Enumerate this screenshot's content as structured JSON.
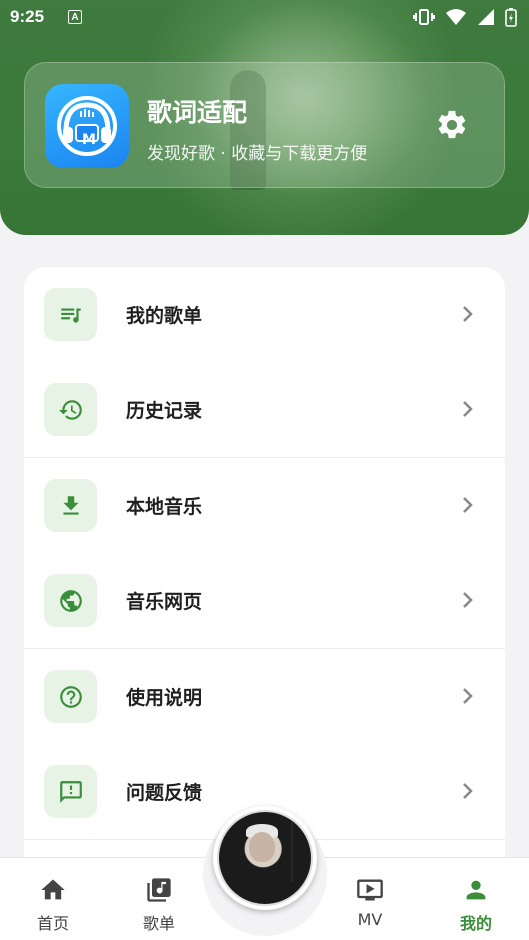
{
  "status_bar": {
    "time": "9:25",
    "notification_icon_letter": "A",
    "icons": [
      "vibrate-icon",
      "wifi-icon",
      "signal-icon",
      "battery-charging-icon"
    ]
  },
  "profile": {
    "app_name": "歌词适配",
    "tagline": "发现好歌 · 收藏与下载更方便",
    "logo_icon": "headphones-logo-icon",
    "logo_letter": "M",
    "settings_icon": "gear-icon"
  },
  "menu": {
    "items": [
      {
        "label": "我的歌单",
        "icon": "playlist-icon"
      },
      {
        "label": "历史记录",
        "icon": "history-icon"
      },
      {
        "label": "本地音乐",
        "icon": "download-icon"
      },
      {
        "label": "音乐网页",
        "icon": "globe-icon"
      },
      {
        "label": "使用说明",
        "icon": "help-circle-icon"
      },
      {
        "label": "问题反馈",
        "icon": "feedback-icon"
      }
    ]
  },
  "bottom_nav": {
    "items": [
      {
        "label": "首页",
        "icon": "home-icon",
        "active": false
      },
      {
        "label": "歌单",
        "icon": "music-note-icon",
        "active": false
      },
      {
        "label": "MV",
        "icon": "tv-play-icon",
        "active": false
      },
      {
        "label": "我的",
        "icon": "person-icon",
        "active": true
      }
    ]
  },
  "colors": {
    "primary_green": "#3a8e3a",
    "header_green": "#3a7a3a",
    "icon_bg": "#e6f3e5",
    "logo_blue": "#1a84f0"
  }
}
